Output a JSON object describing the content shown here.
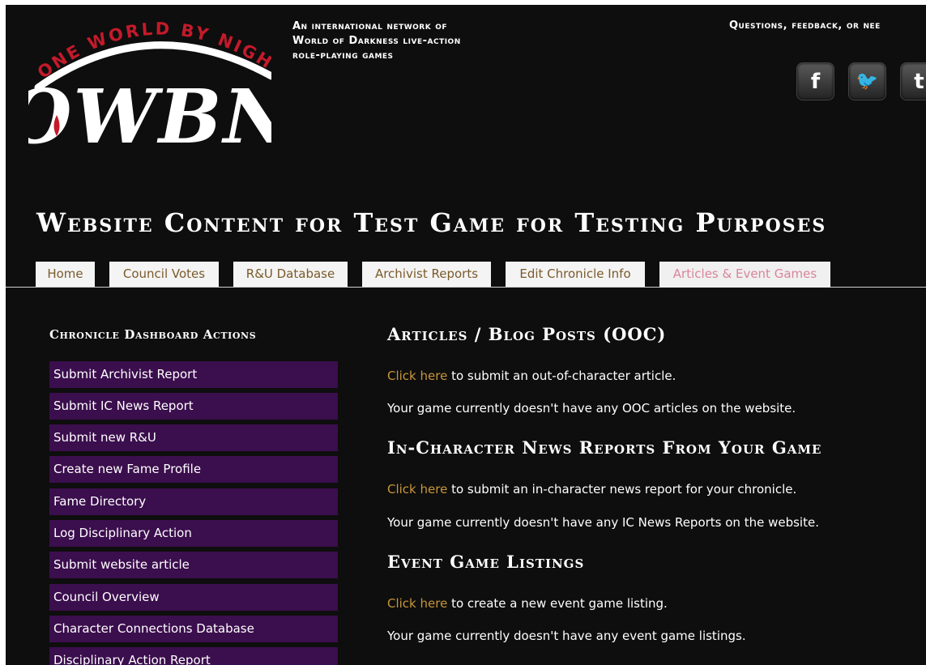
{
  "brand": {
    "logo_top_text": "ONE WORLD BY NIGHT",
    "logo_letters": "OWBN"
  },
  "header": {
    "tagline": [
      "An international network of",
      "World of Darkness live-action",
      "role-playing games"
    ],
    "contact_text": "Questions, feedback, or nee",
    "social": {
      "facebook": "f",
      "twitter": "🐦",
      "tumblr": "t"
    }
  },
  "site_title": "Website Content for Test Game for Testing Purposes",
  "tabs": [
    {
      "label": "Home",
      "active": false
    },
    {
      "label": "Council Votes",
      "active": false
    },
    {
      "label": "R&U Database",
      "active": false
    },
    {
      "label": "Archivist Reports",
      "active": false
    },
    {
      "label": "Edit Chronicle Info",
      "active": false
    },
    {
      "label": "Articles & Event Games",
      "active": true
    }
  ],
  "sidebar": {
    "heading": "Chronicle Dashboard Actions",
    "items": [
      "Submit Archivist Report",
      "Submit IC News Report",
      "Submit new R&U",
      "Create new Fame Profile",
      "Fame Directory",
      "Log Disciplinary Action",
      "Submit website article",
      "Council Overview",
      "Character Connections Database",
      "Disciplinary Action Report"
    ]
  },
  "sections": [
    {
      "heading": "Articles / Blog Posts (OOC)",
      "link": "Click here",
      "link_suffix": " to submit an out-of-character article.",
      "status": "Your game currently doesn't have any OOC articles on the website."
    },
    {
      "heading": "In-Character News Reports From Your Game",
      "link": "Click here",
      "link_suffix": " to submit an in-character news report for your chronicle.",
      "status": "Your game currently doesn't have any IC News Reports on the website."
    },
    {
      "heading": "Event Game Listings",
      "link": "Click here",
      "link_suffix": " to create a new event game listing.",
      "status": "Your game currently doesn't have any event game listings."
    }
  ],
  "colors": {
    "page_bg": "#0e0e0e",
    "sidebar_item_bg": "#3b0e4d",
    "link": "#c8963a",
    "active_tab": "#d9849a"
  }
}
